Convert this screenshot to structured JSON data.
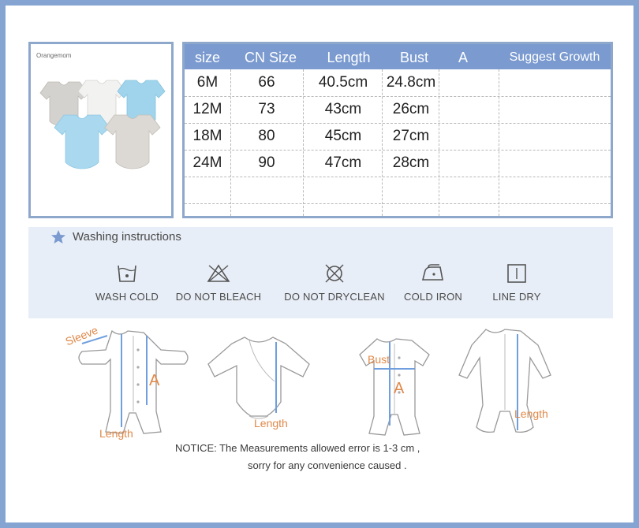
{
  "photo": {
    "brand": "Orangemom"
  },
  "size_table": {
    "columns": [
      "size",
      "CN Size",
      "Length",
      "Bust",
      "A",
      "Suggest Growth"
    ],
    "rows": [
      [
        "6M",
        "66",
        "40.5cm",
        "24.8cm",
        "",
        ""
      ],
      [
        "12M",
        "73",
        "43cm",
        "26cm",
        "",
        ""
      ],
      [
        "18M",
        "80",
        "45cm",
        "27cm",
        "",
        ""
      ],
      [
        "24M",
        "90",
        "47cm",
        "28cm",
        "",
        ""
      ],
      [
        "",
        "",
        "",
        "",
        "",
        ""
      ],
      [
        "",
        "",
        "",
        "",
        "",
        ""
      ]
    ]
  },
  "washing": {
    "title": "Washing instructions",
    "items": [
      {
        "label": "WASH COLD",
        "icon": "wash-cold-icon"
      },
      {
        "label": "DO NOT BLEACH",
        "icon": "do-not-bleach-icon"
      },
      {
        "label": "DO NOT DRYCLEAN",
        "icon": "do-not-dryclean-icon"
      },
      {
        "label": "COLD IRON",
        "icon": "cold-iron-icon"
      },
      {
        "label": "LINE DRY",
        "icon": "line-dry-icon"
      }
    ]
  },
  "measure_labels": {
    "sleeve": "Sleeve",
    "a": "A",
    "length": "Length",
    "bust": "Bust"
  },
  "notice": {
    "line1": "NOTICE:   The Measurements allowed error is 1-3 cm ,",
    "line2": "sorry for any convenience caused ."
  },
  "colors": {
    "frame": "#86a4d2",
    "header": "#7a9ad0",
    "accent": "#e0894a",
    "measure_line": "#6f9fde"
  }
}
